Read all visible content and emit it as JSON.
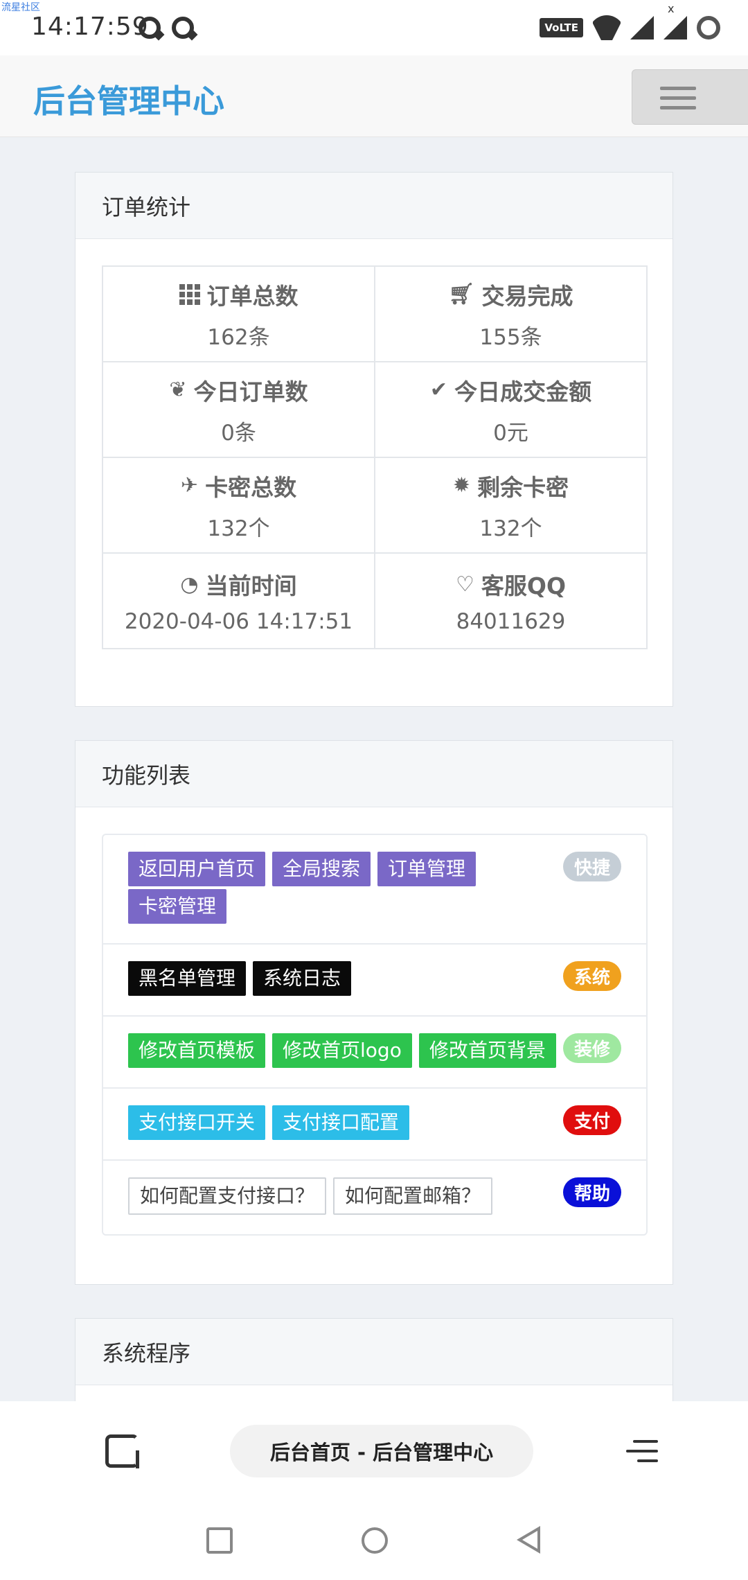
{
  "watermark": "流星社区",
  "status_bar": {
    "time": "14:17:59",
    "volte": "VoLTE"
  },
  "navbar": {
    "brand": "后台管理中心",
    "menu_icon": "hamburger-icon"
  },
  "order_stats": {
    "title": "订单统计",
    "items": [
      {
        "label": "订单总数",
        "value": "162条",
        "icon": "grid-icon"
      },
      {
        "label": "交易完成",
        "value": "155条",
        "icon": "cart-icon"
      },
      {
        "label": "今日订单数",
        "value": "0条",
        "icon": "leaf-icon"
      },
      {
        "label": "今日成交金额",
        "value": "0元",
        "icon": "check-icon"
      },
      {
        "label": "卡密总数",
        "value": "132个",
        "icon": "plane-icon"
      },
      {
        "label": "剩余卡密",
        "value": "132个",
        "icon": "certificate-icon"
      },
      {
        "label": "当前时间",
        "value": "2020-04-06 14:17:51",
        "icon": "dashboard-icon"
      },
      {
        "label": "客服QQ",
        "value": "84011629",
        "icon": "heart-icon"
      }
    ]
  },
  "functions": {
    "title": "功能列表",
    "rows": [
      {
        "badge": "快捷",
        "badge_color": "#c5ced6",
        "tags": [
          "返回用户首页",
          "全局搜索",
          "订单管理",
          "卡密管理"
        ],
        "tag_color": "#7a68c7"
      },
      {
        "badge": "系统",
        "badge_color": "#f0a11e",
        "tags": [
          "黑名单管理",
          "系统日志"
        ],
        "tag_color": "#0a0a0a"
      },
      {
        "badge": "装修",
        "badge_color": "#9fe8a0",
        "tags": [
          "修改首页模板",
          "修改首页logo",
          "修改首页背景"
        ],
        "tag_color": "#2dc44e"
      },
      {
        "badge": "支付",
        "badge_color": "#e00e0e",
        "tags": [
          "支付接口开关",
          "支付接口配置"
        ],
        "tag_color": "#2cbde8"
      },
      {
        "badge": "帮助",
        "badge_color": "#0a10d8",
        "tags": [
          "如何配置支付接口？",
          "如何配置邮箱？"
        ],
        "tag_color": "outline"
      }
    ]
  },
  "system_panel": {
    "title": "系统程序"
  },
  "browser_bar": {
    "page_title": "后台首页 - 后台管理中心"
  }
}
